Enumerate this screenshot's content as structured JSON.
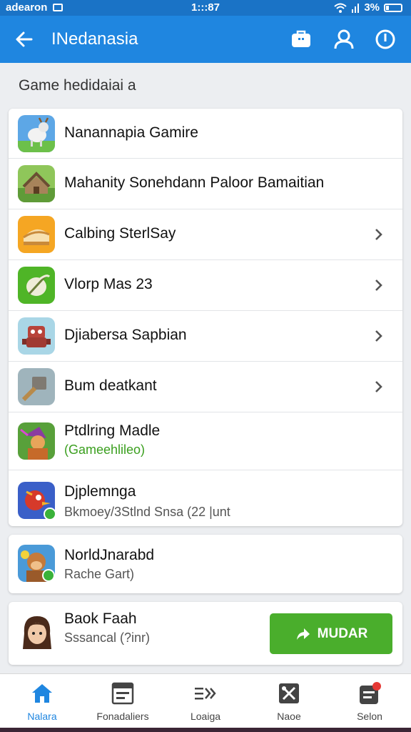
{
  "status_bar": {
    "carrier": "adearon",
    "time": "1:::87",
    "battery": "3%"
  },
  "app_bar": {
    "title": "INedanasia"
  },
  "section": {
    "title": "Game hedidaiai a"
  },
  "games": [
    {
      "name": "Nanannapia Gamire",
      "icon": "game-icon-goat",
      "chevron": false
    },
    {
      "name": "Mahanity Sonehdann Paloor Bamaitian",
      "icon": "game-icon-village",
      "chevron": false
    },
    {
      "name": "Calbing SterlSay",
      "icon": "game-icon-food",
      "chevron": true
    },
    {
      "name": "Vlorp Mas 23",
      "icon": "game-icon-leaf",
      "chevron": true
    },
    {
      "name": "Djiabersa Sapbian",
      "icon": "game-icon-robot",
      "chevron": true
    },
    {
      "name": "Bum deatkant",
      "icon": "game-icon-hammer",
      "chevron": true
    },
    {
      "name": "Ptdlring Madle",
      "subtitle": "(Gameehlileo)",
      "icon": "game-icon-wizard",
      "chevron": false
    },
    {
      "name": "Djplemnga",
      "subtitle": "Bkmoey/3Stlnd Snsa (22 |unt",
      "icon": "game-icon-bird",
      "chevron": false
    }
  ],
  "featured": {
    "name": "NorldJnarabd",
    "subtitle": "Rache Gart)",
    "icon": "game-icon-monkey"
  },
  "profile": {
    "name": "Baok Faah",
    "subtitle": "Sssancal (?inr)",
    "button_label": "MUDAR",
    "button_icon": "share-arrow-icon",
    "button_color": "#4aae2c"
  },
  "bottom_nav": [
    {
      "label": "Nalara",
      "icon": "home-icon",
      "active": true
    },
    {
      "label": "Fonadaliers",
      "icon": "calendar-list-icon",
      "active": false
    },
    {
      "label": "Loaiga",
      "icon": "list-arrows-icon",
      "active": false
    },
    {
      "label": "Naoe",
      "icon": "tools-icon",
      "active": false
    },
    {
      "label": "Selon",
      "icon": "notifications-icon",
      "active": false
    }
  ],
  "colors": {
    "app_bar": "#1f86e0",
    "status_bar": "#1a73c6",
    "accent_green": "#4aae2c"
  }
}
